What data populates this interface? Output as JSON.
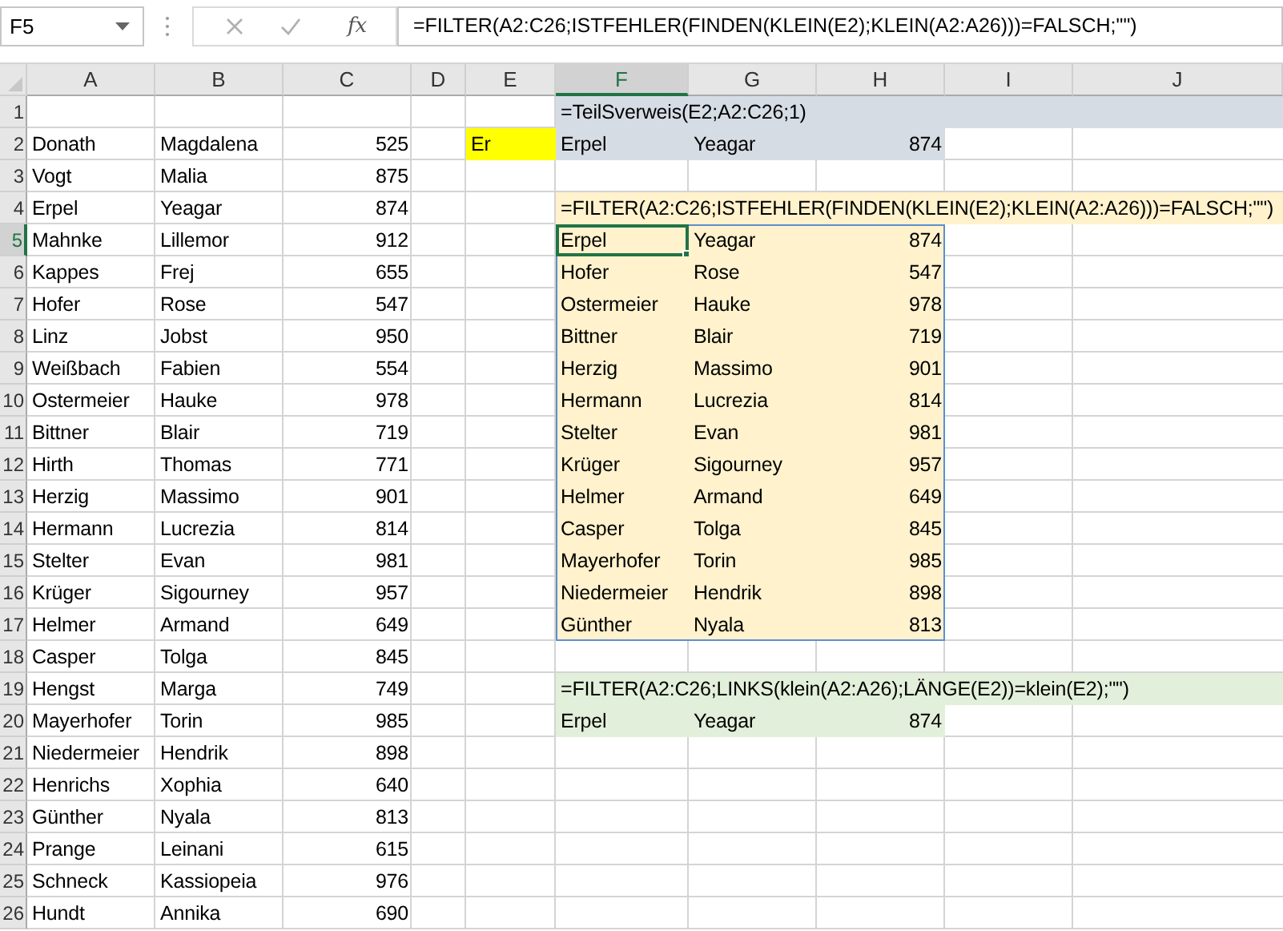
{
  "formula_bar": {
    "name_box": "F5",
    "fx_label": "fx",
    "formula": "=FILTER(A2:C26;ISTFEHLER(FINDEN(KLEIN(E2);KLEIN(A2:A26)))=FALSCH;\"\")"
  },
  "columns": [
    {
      "label": "A",
      "selected": false
    },
    {
      "label": "B",
      "selected": false
    },
    {
      "label": "C",
      "selected": false,
      "kind": "number"
    },
    {
      "label": "D",
      "selected": false
    },
    {
      "label": "E",
      "selected": false
    },
    {
      "label": "F",
      "selected": true
    },
    {
      "label": "G",
      "selected": false
    },
    {
      "label": "H",
      "selected": false,
      "kind": "number"
    },
    {
      "label": "I",
      "selected": false
    },
    {
      "label": "J",
      "selected": false
    }
  ],
  "rows": [
    {
      "label": "1",
      "selected": false,
      "spill": false,
      "cells": {
        "F": {
          "color": "#d6dce4",
          "text": "=TeilSverweis(E2;A2:C26;1)"
        },
        "G": {
          "color": "#d6dce4"
        },
        "H": {
          "color": "#d6dce4"
        },
        "I": {
          "color": "#d6dce4"
        },
        "J": {
          "color": "#d6dce4"
        }
      }
    },
    {
      "label": "2",
      "selected": false,
      "spill": false,
      "cells": {
        "A": {
          "text": "Donath"
        },
        "B": {
          "text": "Magdalena"
        },
        "C": {
          "text": "525"
        },
        "E": {
          "color": "#ffff00",
          "text": "Er"
        },
        "F": {
          "color": "#d6dce4",
          "text": "Erpel"
        },
        "G": {
          "color": "#d6dce4",
          "text": "Yeagar"
        },
        "H": {
          "color": "#d6dce4",
          "text": "874"
        }
      }
    },
    {
      "label": "3",
      "selected": false,
      "spill": false,
      "cells": {
        "A": {
          "text": "Vogt"
        },
        "B": {
          "text": "Malia"
        },
        "C": {
          "text": "875"
        }
      }
    },
    {
      "label": "4",
      "selected": false,
      "spill": false,
      "cells": {
        "A": {
          "text": "Erpel"
        },
        "B": {
          "text": "Yeagar"
        },
        "C": {
          "text": "874"
        },
        "F": {
          "color": "#fff2cc",
          "text": "=FILTER(A2:C26;ISTFEHLER(FINDEN(KLEIN(E2);KLEIN(A2:A26)))=FALSCH;\"\")"
        },
        "G": {
          "color": "#fff2cc"
        },
        "H": {
          "color": "#fff2cc"
        },
        "I": {
          "color": "#fff2cc"
        },
        "J": {
          "color": "#fff2cc"
        }
      }
    },
    {
      "label": "5",
      "selected": true,
      "spill": true,
      "cells": {
        "A": {
          "text": "Mahnke"
        },
        "B": {
          "text": "Lillemor"
        },
        "C": {
          "text": "912"
        },
        "F": {
          "color": "#fff2cc",
          "text": "Erpel",
          "selected": true
        },
        "G": {
          "color": "#fff2cc",
          "text": "Yeagar"
        },
        "H": {
          "color": "#fff2cc",
          "text": "874"
        }
      }
    },
    {
      "label": "6",
      "selected": false,
      "spill": true,
      "cells": {
        "A": {
          "text": "Kappes"
        },
        "B": {
          "text": "Frej"
        },
        "C": {
          "text": "655"
        },
        "F": {
          "color": "#fff2cc",
          "text": "Hofer"
        },
        "G": {
          "color": "#fff2cc",
          "text": "Rose"
        },
        "H": {
          "color": "#fff2cc",
          "text": "547"
        }
      }
    },
    {
      "label": "7",
      "selected": false,
      "spill": true,
      "cells": {
        "A": {
          "text": "Hofer"
        },
        "B": {
          "text": "Rose"
        },
        "C": {
          "text": "547"
        },
        "F": {
          "color": "#fff2cc",
          "text": "Ostermeier"
        },
        "G": {
          "color": "#fff2cc",
          "text": "Hauke"
        },
        "H": {
          "color": "#fff2cc",
          "text": "978"
        }
      }
    },
    {
      "label": "8",
      "selected": false,
      "spill": true,
      "cells": {
        "A": {
          "text": "Linz"
        },
        "B": {
          "text": "Jobst"
        },
        "C": {
          "text": "950"
        },
        "F": {
          "color": "#fff2cc",
          "text": "Bittner"
        },
        "G": {
          "color": "#fff2cc",
          "text": "Blair"
        },
        "H": {
          "color": "#fff2cc",
          "text": "719"
        }
      }
    },
    {
      "label": "9",
      "selected": false,
      "spill": true,
      "cells": {
        "A": {
          "text": "Weißbach"
        },
        "B": {
          "text": "Fabien"
        },
        "C": {
          "text": "554"
        },
        "F": {
          "color": "#fff2cc",
          "text": "Herzig"
        },
        "G": {
          "color": "#fff2cc",
          "text": "Massimo"
        },
        "H": {
          "color": "#fff2cc",
          "text": "901"
        }
      }
    },
    {
      "label": "10",
      "selected": false,
      "spill": true,
      "cells": {
        "A": {
          "text": "Ostermeier"
        },
        "B": {
          "text": "Hauke"
        },
        "C": {
          "text": "978"
        },
        "F": {
          "color": "#fff2cc",
          "text": "Hermann"
        },
        "G": {
          "color": "#fff2cc",
          "text": "Lucrezia"
        },
        "H": {
          "color": "#fff2cc",
          "text": "814"
        }
      }
    },
    {
      "label": "11",
      "selected": false,
      "spill": true,
      "cells": {
        "A": {
          "text": "Bittner"
        },
        "B": {
          "text": "Blair"
        },
        "C": {
          "text": "719"
        },
        "F": {
          "color": "#fff2cc",
          "text": "Stelter"
        },
        "G": {
          "color": "#fff2cc",
          "text": "Evan"
        },
        "H": {
          "color": "#fff2cc",
          "text": "981"
        }
      }
    },
    {
      "label": "12",
      "selected": false,
      "spill": true,
      "cells": {
        "A": {
          "text": "Hirth"
        },
        "B": {
          "text": "Thomas"
        },
        "C": {
          "text": "771"
        },
        "F": {
          "color": "#fff2cc",
          "text": "Krüger"
        },
        "G": {
          "color": "#fff2cc",
          "text": "Sigourney"
        },
        "H": {
          "color": "#fff2cc",
          "text": "957"
        }
      }
    },
    {
      "label": "13",
      "selected": false,
      "spill": true,
      "cells": {
        "A": {
          "text": "Herzig"
        },
        "B": {
          "text": "Massimo"
        },
        "C": {
          "text": "901"
        },
        "F": {
          "color": "#fff2cc",
          "text": "Helmer"
        },
        "G": {
          "color": "#fff2cc",
          "text": "Armand"
        },
        "H": {
          "color": "#fff2cc",
          "text": "649"
        }
      }
    },
    {
      "label": "14",
      "selected": false,
      "spill": true,
      "cells": {
        "A": {
          "text": "Hermann"
        },
        "B": {
          "text": "Lucrezia"
        },
        "C": {
          "text": "814"
        },
        "F": {
          "color": "#fff2cc",
          "text": "Casper"
        },
        "G": {
          "color": "#fff2cc",
          "text": "Tolga"
        },
        "H": {
          "color": "#fff2cc",
          "text": "845"
        }
      }
    },
    {
      "label": "15",
      "selected": false,
      "spill": true,
      "cells": {
        "A": {
          "text": "Stelter"
        },
        "B": {
          "text": "Evan"
        },
        "C": {
          "text": "981"
        },
        "F": {
          "color": "#fff2cc",
          "text": "Mayerhofer"
        },
        "G": {
          "color": "#fff2cc",
          "text": "Torin"
        },
        "H": {
          "color": "#fff2cc",
          "text": "985"
        }
      }
    },
    {
      "label": "16",
      "selected": false,
      "spill": true,
      "cells": {
        "A": {
          "text": "Krüger"
        },
        "B": {
          "text": "Sigourney"
        },
        "C": {
          "text": "957"
        },
        "F": {
          "color": "#fff2cc",
          "text": "Niedermeier"
        },
        "G": {
          "color": "#fff2cc",
          "text": "Hendrik"
        },
        "H": {
          "color": "#fff2cc",
          "text": "898"
        }
      }
    },
    {
      "label": "17",
      "selected": false,
      "spill": true,
      "cells": {
        "A": {
          "text": "Helmer"
        },
        "B": {
          "text": "Armand"
        },
        "C": {
          "text": "649"
        },
        "F": {
          "color": "#fff2cc",
          "text": "Günther"
        },
        "G": {
          "color": "#fff2cc",
          "text": "Nyala"
        },
        "H": {
          "color": "#fff2cc",
          "text": "813"
        }
      }
    },
    {
      "label": "18",
      "selected": false,
      "spill": false,
      "cells": {
        "A": {
          "text": "Casper"
        },
        "B": {
          "text": "Tolga"
        },
        "C": {
          "text": "845"
        }
      }
    },
    {
      "label": "19",
      "selected": false,
      "spill": false,
      "cells": {
        "A": {
          "text": "Hengst"
        },
        "B": {
          "text": "Marga"
        },
        "C": {
          "text": "749"
        },
        "F": {
          "color": "#e2efda",
          "text": "=FILTER(A2:C26;LINKS(klein(A2:A26);LÄNGE(E2))=klein(E2);\"\")"
        },
        "G": {
          "color": "#e2efda"
        },
        "H": {
          "color": "#e2efda"
        },
        "I": {
          "color": "#e2efda"
        },
        "J": {
          "color": "#e2efda"
        }
      }
    },
    {
      "label": "20",
      "selected": false,
      "spill": false,
      "cells": {
        "A": {
          "text": "Mayerhofer"
        },
        "B": {
          "text": "Torin"
        },
        "C": {
          "text": "985"
        },
        "F": {
          "color": "#e2efda",
          "text": "Erpel"
        },
        "G": {
          "color": "#e2efda",
          "text": "Yeagar"
        },
        "H": {
          "color": "#e2efda",
          "text": "874"
        }
      }
    },
    {
      "label": "21",
      "selected": false,
      "spill": false,
      "cells": {
        "A": {
          "text": "Niedermeier"
        },
        "B": {
          "text": "Hendrik"
        },
        "C": {
          "text": "898"
        }
      }
    },
    {
      "label": "22",
      "selected": false,
      "spill": false,
      "cells": {
        "A": {
          "text": "Henrichs"
        },
        "B": {
          "text": "Xophia"
        },
        "C": {
          "text": "640"
        }
      }
    },
    {
      "label": "23",
      "selected": false,
      "spill": false,
      "cells": {
        "A": {
          "text": "Günther"
        },
        "B": {
          "text": "Nyala"
        },
        "C": {
          "text": "813"
        }
      }
    },
    {
      "label": "24",
      "selected": false,
      "spill": false,
      "cells": {
        "A": {
          "text": "Prange"
        },
        "B": {
          "text": "Leinani"
        },
        "C": {
          "text": "615"
        }
      }
    },
    {
      "label": "25",
      "selected": false,
      "spill": false,
      "cells": {
        "A": {
          "text": "Schneck"
        },
        "B": {
          "text": "Kassiopeia"
        },
        "C": {
          "text": "976"
        }
      }
    },
    {
      "label": "26",
      "selected": false,
      "spill": false,
      "cells": {
        "A": {
          "text": "Hundt"
        },
        "B": {
          "text": "Annika"
        },
        "C": {
          "text": "690"
        }
      }
    }
  ]
}
